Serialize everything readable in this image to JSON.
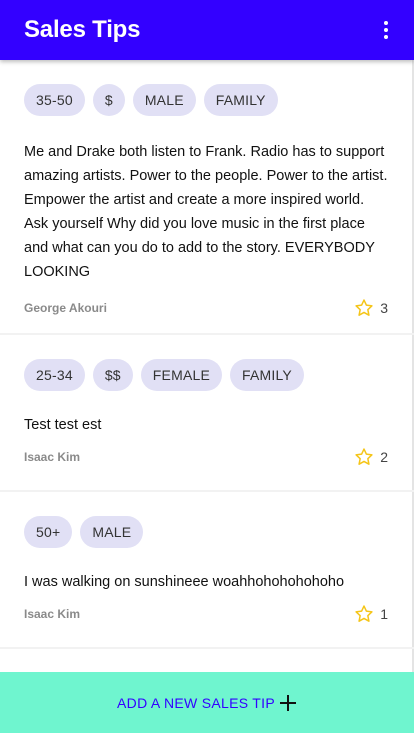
{
  "appbar": {
    "title": "Sales Tips",
    "menu_icon": "more-vert-icon"
  },
  "tips": [
    {
      "tags": [
        "35-50",
        "$",
        "MALE",
        "FAMILY"
      ],
      "text": "Me and Drake both listen to Frank. Radio has to support amazing artists. Power to the people. Power to the artist. Empower the artist and create a more inspired world. Ask yourself Why did you love music in the first place and what can you do to add to the story. EVERYBODY LOOKING",
      "author": "George Akouri",
      "stars": "3"
    },
    {
      "tags": [
        "25-34",
        "$$",
        "FEMALE",
        "FAMILY"
      ],
      "text": "Test test est",
      "author": "Isaac Kim",
      "stars": "2"
    },
    {
      "tags": [
        "50+",
        "MALE"
      ],
      "text": "I was walking on sunshineee woahhohohohohoho",
      "author": "Isaac Kim",
      "stars": "1"
    }
  ],
  "bottom_bar": {
    "label": "ADD A NEW SALES TIP",
    "icon": "plus-icon"
  },
  "colors": {
    "primary": "#3300ff",
    "accent": "#6ff5cf",
    "tag_bg": "#e1e0f5",
    "star": "#f5c518"
  }
}
